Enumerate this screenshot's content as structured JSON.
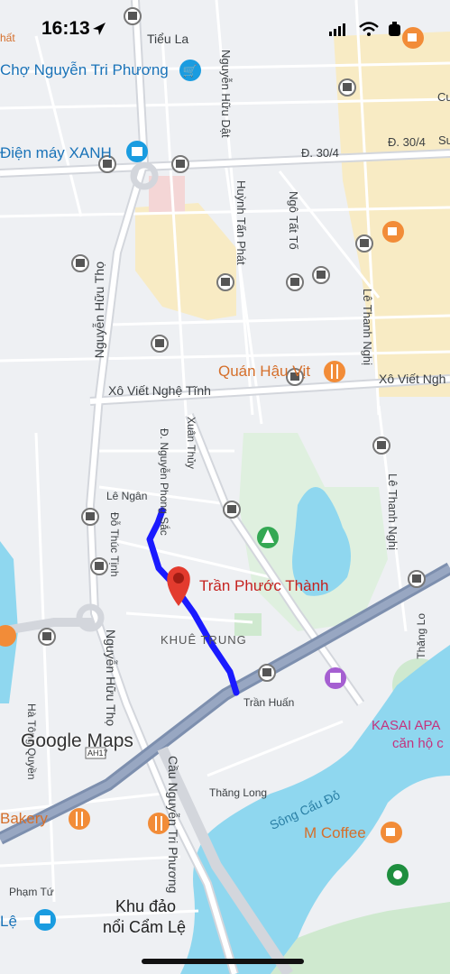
{
  "status_bar": {
    "time": "16:13"
  },
  "map": {
    "streets": {
      "tieu_la": "Tiểu La",
      "nguyen_huu_dat": "Nguyễn Hữu Dật",
      "d_30_4_a": "Đ. 30/4",
      "d_30_4_b": "Đ. 30/4",
      "huynh_tan_phat": "Huỳnh Tấn Phát",
      "ngo_tat_to": "Ngô Tất Tố",
      "le_thanh_nghi_n": "Lê Thanh Nghị",
      "le_thanh_nghi_s": "Lê Thanh Nghị",
      "nguyen_huu_tho_n": "Nguyễn Hữu Thọ",
      "nguyen_huu_tho_s": "Nguyễn Hữu Thọ",
      "xo_viet_nghe_tinh_w": "Xô Viết Nghệ Tĩnh",
      "xo_viet_nghe_tinh_e": "Xô Viết Ngh",
      "xuan_thuy": "Xuân Thủy",
      "nguyen_phong_sac": "Đ. Nguyễn Phong Sắc",
      "le_ngan": "Lê Ngân",
      "do_thuc_tinh": "Đỗ Thúc Tịnh",
      "tran_huan": "Trần Huấn",
      "ha_tong_quyen": "Hà Tông Quyền",
      "thang_long_w": "Thăng Long",
      "thang_long_e": "Thăng Lo",
      "cau_nguyen_tri_phuong": "Cầu Nguyễn Tri Phương",
      "pham_tu": "Phạm Tứ",
      "road_shield": "AH17"
    },
    "places": {
      "cho_nguyen_tri_phuong": "Chợ Nguyễn Tri Phương",
      "dien_may_xanh": "Điện máy XANH",
      "quan_hau_vit": "Quán Hậu Vịt",
      "tran_phuoc_thanh": "Trần Phước Thành",
      "khue_trung": "KHUÊ TRUNG",
      "kasai_1": "KASAI APA",
      "kasai_2": "căn hộ c",
      "bakery": "Bakery",
      "m_coffee": "M Coffee",
      "song_cau_do": "Sông Cẩu Đỏ",
      "khu_dao_1": "Khu đảo",
      "khu_dao_2": "nổi Cẩm Lệ",
      "le_partial": "Lệ",
      "nhat_partial": "hất",
      "cu_partial": "Cu",
      "su_partial": "Sư"
    },
    "logo": "Google Maps"
  },
  "colors": {
    "route": "#1a1aff",
    "pin": "#e33b2e",
    "water": "#8fd7ef",
    "park": "#bfe6c4",
    "orange_poi": "#f28c38",
    "blue_poi": "#1a9ce0",
    "purple_poi": "#a55fd1"
  }
}
